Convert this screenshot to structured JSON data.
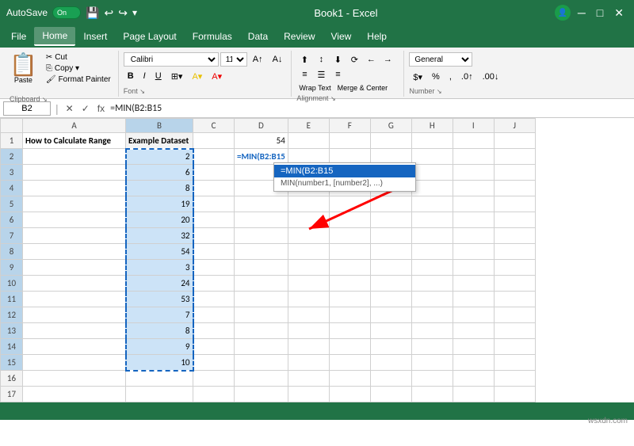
{
  "titlebar": {
    "autosave_label": "AutoSave",
    "autosave_state": "On",
    "title": "Book1 - Excel",
    "undo_icon": "↩",
    "redo_icon": "↪"
  },
  "menubar": {
    "items": [
      "File",
      "Home",
      "Insert",
      "Page Layout",
      "Formulas",
      "Data",
      "Review",
      "View",
      "Help"
    ]
  },
  "ribbon": {
    "clipboard": {
      "label": "Clipboard",
      "paste_label": "Paste",
      "cut_label": "✂ Cut",
      "copy_label": "⎘ Copy",
      "format_painter_label": "Format Painter"
    },
    "font": {
      "label": "Font",
      "font_name": "Calibri",
      "font_size": "11",
      "bold": "B",
      "italic": "I",
      "underline": "U",
      "border_icon": "⊞",
      "fill_icon": "A",
      "color_icon": "A"
    },
    "alignment": {
      "label": "Alignment",
      "wrap_text": "Wrap Text",
      "merge_center": "Merge & Center"
    },
    "number": {
      "label": "Number",
      "format": "General",
      "dollar": "$",
      "percent": "%",
      "comma": ",",
      "increase_decimal": ".0",
      "decrease_decimal": ".00"
    }
  },
  "formulabar": {
    "name_box": "B2",
    "formula": "=MIN(B2:B15",
    "fx_label": "fx"
  },
  "grid": {
    "col_headers": [
      "",
      "A",
      "B",
      "C",
      "D",
      "E",
      "F",
      "G",
      "H",
      "I",
      "J"
    ],
    "rows": [
      {
        "row": 1,
        "A": "How to Calculate Range",
        "B": "Example Dataset",
        "C": "",
        "D": "54",
        "E": "",
        "F": "",
        "G": ""
      },
      {
        "row": 2,
        "A": "",
        "B": "2",
        "C": "",
        "D": "=MIN(B2:B15",
        "E": "",
        "F": "",
        "G": ""
      },
      {
        "row": 3,
        "A": "",
        "B": "6",
        "C": "",
        "D": "",
        "E": "",
        "F": "",
        "G": ""
      },
      {
        "row": 4,
        "A": "",
        "B": "8",
        "C": "",
        "D": "",
        "E": "",
        "F": "",
        "G": ""
      },
      {
        "row": 5,
        "A": "",
        "B": "19",
        "C": "",
        "D": "",
        "E": "",
        "F": "",
        "G": ""
      },
      {
        "row": 6,
        "A": "",
        "B": "20",
        "C": "",
        "D": "",
        "E": "",
        "F": "",
        "G": ""
      },
      {
        "row": 7,
        "A": "",
        "B": "32",
        "C": "",
        "D": "",
        "E": "",
        "F": "",
        "G": ""
      },
      {
        "row": 8,
        "A": "",
        "B": "54",
        "C": "",
        "D": "",
        "E": "",
        "F": "",
        "G": ""
      },
      {
        "row": 9,
        "A": "",
        "B": "3",
        "C": "",
        "D": "",
        "E": "",
        "F": "",
        "G": ""
      },
      {
        "row": 10,
        "A": "",
        "B": "24",
        "C": "",
        "D": "",
        "E": "",
        "F": "",
        "G": ""
      },
      {
        "row": 11,
        "A": "",
        "B": "53",
        "C": "",
        "D": "",
        "E": "",
        "F": "",
        "G": ""
      },
      {
        "row": 12,
        "A": "",
        "B": "7",
        "C": "",
        "D": "",
        "E": "",
        "F": "",
        "G": ""
      },
      {
        "row": 13,
        "A": "",
        "B": "8",
        "C": "",
        "D": "",
        "E": "",
        "F": "",
        "G": ""
      },
      {
        "row": 14,
        "A": "",
        "B": "9",
        "C": "",
        "D": "",
        "E": "",
        "F": "",
        "G": ""
      },
      {
        "row": 15,
        "A": "",
        "B": "10",
        "C": "",
        "D": "",
        "E": "",
        "F": "",
        "G": ""
      },
      {
        "row": 16,
        "A": "",
        "B": "",
        "C": "",
        "D": "",
        "E": "",
        "F": "",
        "G": ""
      },
      {
        "row": 17,
        "A": "",
        "B": "",
        "C": "",
        "D": "",
        "E": "",
        "F": "",
        "G": ""
      }
    ],
    "formula_popup": {
      "active": "=MIN(B2:B15",
      "hint": "MIN(number1, [number2], ...)"
    }
  },
  "statusbar": {
    "watermark": "wsxdn.com"
  }
}
